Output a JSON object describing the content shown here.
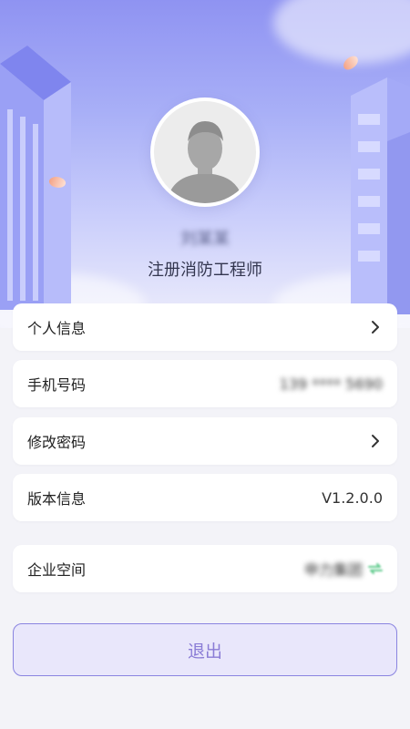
{
  "profile": {
    "name": "刘某某",
    "title": "注册消防工程师"
  },
  "menu": {
    "personal_info": {
      "label": "个人信息",
      "icon": "chevron-right-icon"
    },
    "phone": {
      "label": "手机号码",
      "value": "139 **** 5690"
    },
    "change_password": {
      "label": "修改密码",
      "icon": "chevron-right-icon"
    },
    "version": {
      "label": "版本信息",
      "value": "V1.2.0.0"
    },
    "enterprise": {
      "label": "企业空间",
      "value": "申力集团",
      "icon": "switch-icon"
    }
  },
  "logout": {
    "label": "退出"
  },
  "colors": {
    "accent": "#8a7cd6",
    "hero_top": "#8f93f2",
    "background": "#f3f3f8",
    "switch_icon": "#5cc98a"
  }
}
